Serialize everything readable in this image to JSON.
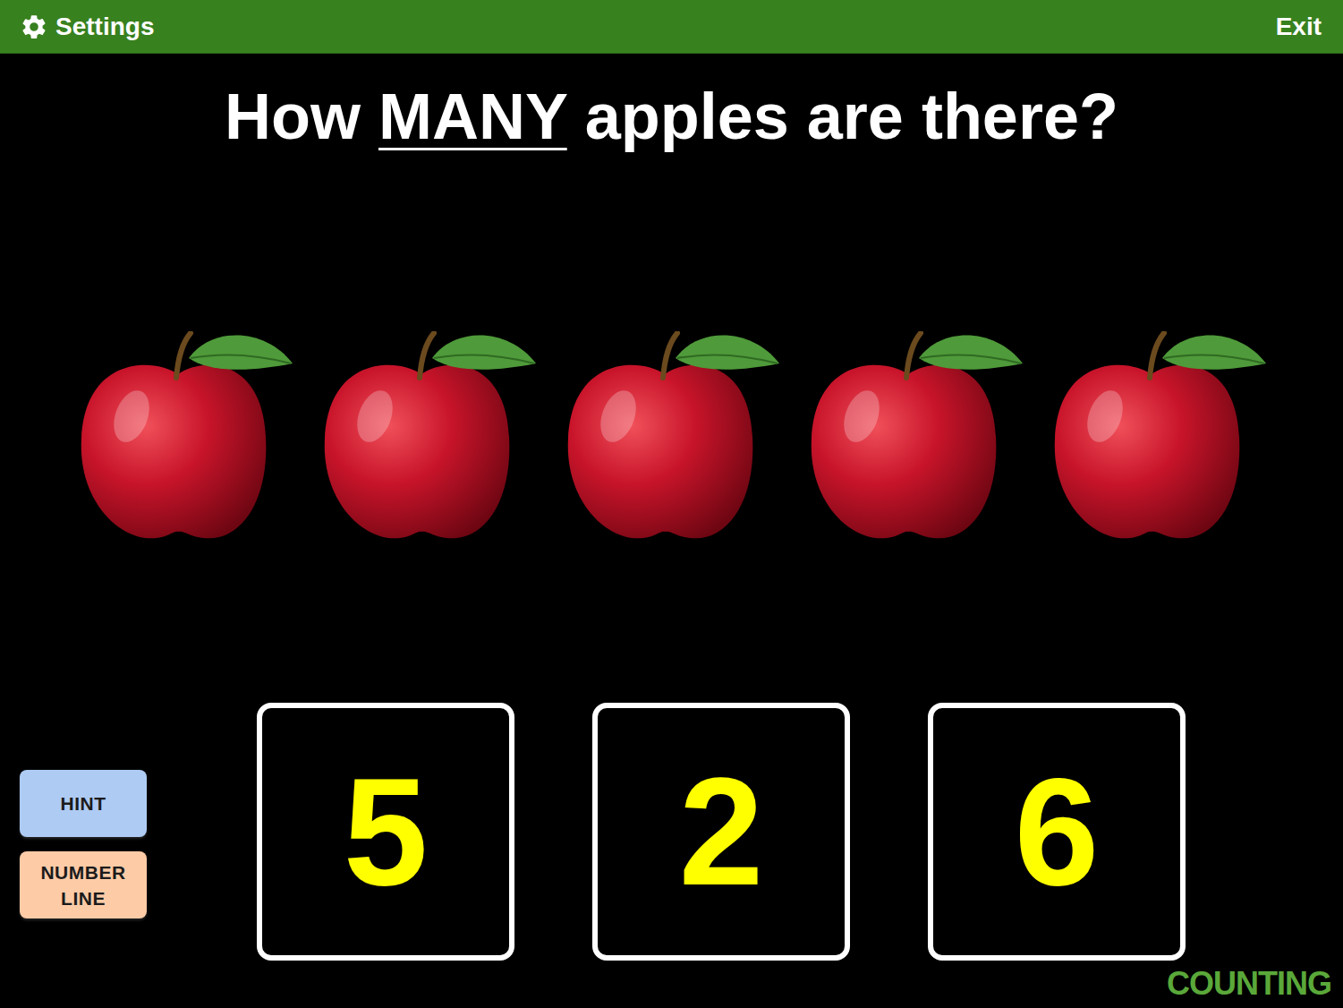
{
  "top_bar": {
    "settings": "Settings",
    "exit": "Exit"
  },
  "question": [
    {
      "text": "How ",
      "underlined": false
    },
    {
      "text": "MANY",
      "underlined": true
    },
    {
      "text": " apples are there?",
      "underlined": false
    }
  ],
  "apple_count": 5,
  "tools": [
    {
      "label": "HINT",
      "color": "#aecbf3"
    },
    {
      "label": "NUMBER LINE",
      "color": "#fdcba6"
    }
  ],
  "answers": [
    "5",
    "2",
    "6"
  ],
  "mode_label": "COUNTING"
}
